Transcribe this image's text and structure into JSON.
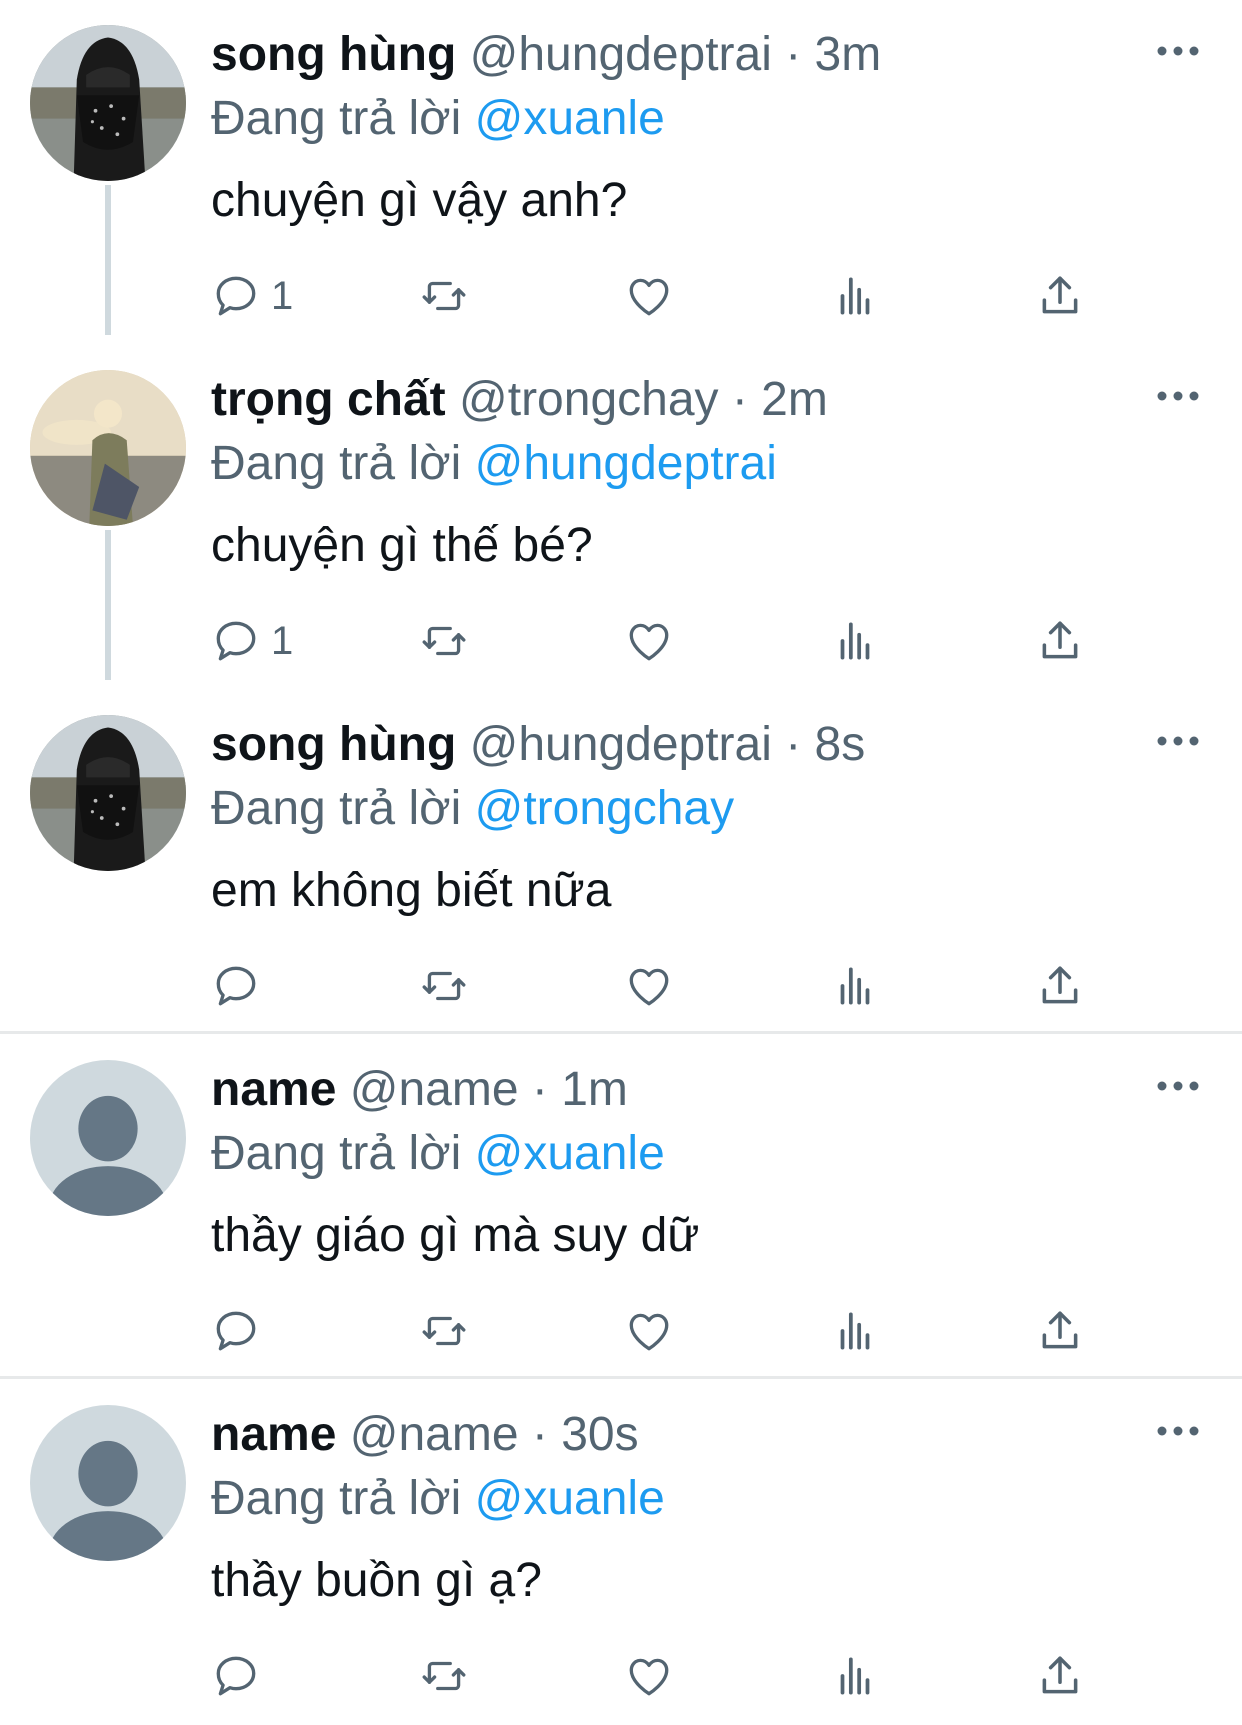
{
  "colors": {
    "link": "#1d9bf0",
    "secondary": "#536471",
    "text": "#0f1419",
    "thread_line": "#cfd9de",
    "divider": "#e7e9ea"
  },
  "tweets": [
    {
      "name": "song hùng",
      "handle": "@hungdeptrai",
      "time": "3m",
      "meta": "@hungdeptrai · 3m",
      "reply_prefix": "Đang trả lời",
      "reply_to": "@xuanle",
      "text": "chuyện gì vậy anh?",
      "reply_count": "1",
      "avatar": "masked-man-photo"
    },
    {
      "name": "trọng chất",
      "handle": "@trongchay",
      "time": "2m",
      "meta": "@trongchay · 2m",
      "reply_prefix": "Đang trả lời",
      "reply_to": "@hungdeptrai",
      "text": "chuyện gì thế bé?",
      "reply_count": "1",
      "avatar": "sunset-man-photo"
    },
    {
      "name": "song hùng",
      "handle": "@hungdeptrai",
      "time": "8s",
      "meta": "@hungdeptrai · 8s",
      "reply_prefix": "Đang trả lời",
      "reply_to": "@trongchay",
      "text": "em không biết nữa",
      "reply_count": "",
      "avatar": "masked-man-photo"
    },
    {
      "name": "name",
      "handle": "@name",
      "time": "1m",
      "meta": "@name · 1m",
      "reply_prefix": "Đang trả lời",
      "reply_to": "@xuanle",
      "text": "thầy giáo gì mà suy dữ",
      "reply_count": "",
      "avatar": "default-avatar"
    },
    {
      "name": "name",
      "handle": "@name",
      "time": "30s",
      "meta": "@name · 30s",
      "reply_prefix": "Đang trả lời",
      "reply_to": "@xuanle",
      "text": "thầy buồn gì ạ?",
      "reply_count": "",
      "avatar": "default-avatar"
    }
  ],
  "icons": {
    "more": "more-icon",
    "reply": "reply-icon",
    "retweet": "retweet-icon",
    "like": "like-icon",
    "views": "views-icon",
    "share": "share-icon"
  }
}
